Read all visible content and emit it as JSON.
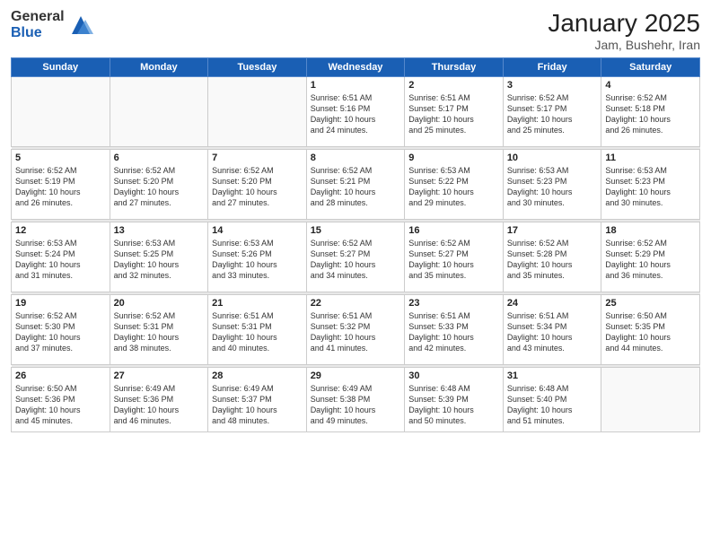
{
  "logo": {
    "general": "General",
    "blue": "Blue"
  },
  "header": {
    "month": "January 2025",
    "location": "Jam, Bushehr, Iran"
  },
  "weekdays": [
    "Sunday",
    "Monday",
    "Tuesday",
    "Wednesday",
    "Thursday",
    "Friday",
    "Saturday"
  ],
  "weeks": [
    [
      {
        "day": "",
        "info": ""
      },
      {
        "day": "",
        "info": ""
      },
      {
        "day": "",
        "info": ""
      },
      {
        "day": "1",
        "info": "Sunrise: 6:51 AM\nSunset: 5:16 PM\nDaylight: 10 hours\nand 24 minutes."
      },
      {
        "day": "2",
        "info": "Sunrise: 6:51 AM\nSunset: 5:17 PM\nDaylight: 10 hours\nand 25 minutes."
      },
      {
        "day": "3",
        "info": "Sunrise: 6:52 AM\nSunset: 5:17 PM\nDaylight: 10 hours\nand 25 minutes."
      },
      {
        "day": "4",
        "info": "Sunrise: 6:52 AM\nSunset: 5:18 PM\nDaylight: 10 hours\nand 26 minutes."
      }
    ],
    [
      {
        "day": "5",
        "info": "Sunrise: 6:52 AM\nSunset: 5:19 PM\nDaylight: 10 hours\nand 26 minutes."
      },
      {
        "day": "6",
        "info": "Sunrise: 6:52 AM\nSunset: 5:20 PM\nDaylight: 10 hours\nand 27 minutes."
      },
      {
        "day": "7",
        "info": "Sunrise: 6:52 AM\nSunset: 5:20 PM\nDaylight: 10 hours\nand 27 minutes."
      },
      {
        "day": "8",
        "info": "Sunrise: 6:52 AM\nSunset: 5:21 PM\nDaylight: 10 hours\nand 28 minutes."
      },
      {
        "day": "9",
        "info": "Sunrise: 6:53 AM\nSunset: 5:22 PM\nDaylight: 10 hours\nand 29 minutes."
      },
      {
        "day": "10",
        "info": "Sunrise: 6:53 AM\nSunset: 5:23 PM\nDaylight: 10 hours\nand 30 minutes."
      },
      {
        "day": "11",
        "info": "Sunrise: 6:53 AM\nSunset: 5:23 PM\nDaylight: 10 hours\nand 30 minutes."
      }
    ],
    [
      {
        "day": "12",
        "info": "Sunrise: 6:53 AM\nSunset: 5:24 PM\nDaylight: 10 hours\nand 31 minutes."
      },
      {
        "day": "13",
        "info": "Sunrise: 6:53 AM\nSunset: 5:25 PM\nDaylight: 10 hours\nand 32 minutes."
      },
      {
        "day": "14",
        "info": "Sunrise: 6:53 AM\nSunset: 5:26 PM\nDaylight: 10 hours\nand 33 minutes."
      },
      {
        "day": "15",
        "info": "Sunrise: 6:52 AM\nSunset: 5:27 PM\nDaylight: 10 hours\nand 34 minutes."
      },
      {
        "day": "16",
        "info": "Sunrise: 6:52 AM\nSunset: 5:27 PM\nDaylight: 10 hours\nand 35 minutes."
      },
      {
        "day": "17",
        "info": "Sunrise: 6:52 AM\nSunset: 5:28 PM\nDaylight: 10 hours\nand 35 minutes."
      },
      {
        "day": "18",
        "info": "Sunrise: 6:52 AM\nSunset: 5:29 PM\nDaylight: 10 hours\nand 36 minutes."
      }
    ],
    [
      {
        "day": "19",
        "info": "Sunrise: 6:52 AM\nSunset: 5:30 PM\nDaylight: 10 hours\nand 37 minutes."
      },
      {
        "day": "20",
        "info": "Sunrise: 6:52 AM\nSunset: 5:31 PM\nDaylight: 10 hours\nand 38 minutes."
      },
      {
        "day": "21",
        "info": "Sunrise: 6:51 AM\nSunset: 5:31 PM\nDaylight: 10 hours\nand 40 minutes."
      },
      {
        "day": "22",
        "info": "Sunrise: 6:51 AM\nSunset: 5:32 PM\nDaylight: 10 hours\nand 41 minutes."
      },
      {
        "day": "23",
        "info": "Sunrise: 6:51 AM\nSunset: 5:33 PM\nDaylight: 10 hours\nand 42 minutes."
      },
      {
        "day": "24",
        "info": "Sunrise: 6:51 AM\nSunset: 5:34 PM\nDaylight: 10 hours\nand 43 minutes."
      },
      {
        "day": "25",
        "info": "Sunrise: 6:50 AM\nSunset: 5:35 PM\nDaylight: 10 hours\nand 44 minutes."
      }
    ],
    [
      {
        "day": "26",
        "info": "Sunrise: 6:50 AM\nSunset: 5:36 PM\nDaylight: 10 hours\nand 45 minutes."
      },
      {
        "day": "27",
        "info": "Sunrise: 6:49 AM\nSunset: 5:36 PM\nDaylight: 10 hours\nand 46 minutes."
      },
      {
        "day": "28",
        "info": "Sunrise: 6:49 AM\nSunset: 5:37 PM\nDaylight: 10 hours\nand 48 minutes."
      },
      {
        "day": "29",
        "info": "Sunrise: 6:49 AM\nSunset: 5:38 PM\nDaylight: 10 hours\nand 49 minutes."
      },
      {
        "day": "30",
        "info": "Sunrise: 6:48 AM\nSunset: 5:39 PM\nDaylight: 10 hours\nand 50 minutes."
      },
      {
        "day": "31",
        "info": "Sunrise: 6:48 AM\nSunset: 5:40 PM\nDaylight: 10 hours\nand 51 minutes."
      },
      {
        "day": "",
        "info": ""
      }
    ]
  ]
}
